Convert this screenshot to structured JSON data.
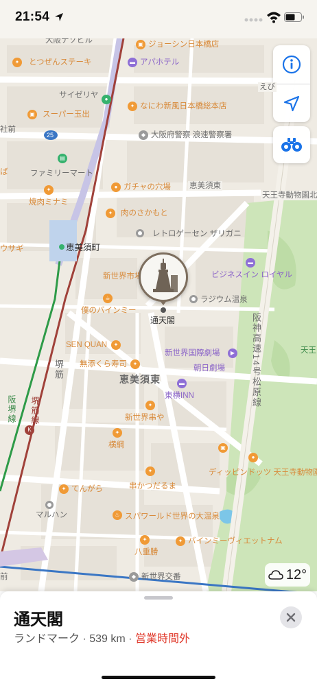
{
  "status": {
    "time": "21:54"
  },
  "map": {
    "labels": {
      "osaka_navi": "大阪ナゾビル",
      "joshin": "ジョーシン日本橋店",
      "tozen": "とつぜんステーキ",
      "apa": "アパホテル",
      "saizeriya": "サイゼリヤ",
      "naniwa": "なにわ新風日本橋総本店",
      "super_tamade": "スーパー玉出",
      "police": "大阪府警察 浪速警察署",
      "route25": "25",
      "familymart": "ファミリーマート",
      "gacha": "ガチャの穴場",
      "ebisu_higashi_small": "恵美須東",
      "tennoji_zoo_small": "天王寺動物園北",
      "yakiniku": "焼肉ミナミ",
      "niku": "肉のさかもと",
      "retro": "レトロゲーセン ザリガニ",
      "usagi": "ウサギ",
      "ebisucho": "恵美須町",
      "shinsekai_ichiba": "新世界市場",
      "radium": "ラジウム温泉",
      "biz_inn": "ビジネスイン ロイヤル",
      "boku_bain": "僕のバインミー",
      "tsutenkaku": "通天閣",
      "hanshin": "阪神高速14号松原線",
      "sen_quan": "SEN QUAN",
      "shinsekai_kokusai": "新世界国際劇場",
      "muten": "無添くら寿司",
      "asahi": "朝日劇場",
      "sakaisuji": "堺筋",
      "ebisu_higashi": "恵美須東",
      "toyoko": "東横INN",
      "hankai": "阪堺線",
      "sakaisuji_line": "堺筋線",
      "shinsekai_kushiya": "新世界串や",
      "yokozuna": "横綱",
      "tennoji_east": "天王",
      "zoo": "ディッピンドッツ 天王寺動物園内FooZoo",
      "tengara": "てんがら",
      "kushikatsu": "串かつだるま",
      "maruhan": "マルハン",
      "spa": "スパワールド世界の大温泉",
      "bain_viet": "バインミーヴィエットナム",
      "yaejikatsu": "八重勝",
      "shinsekai_koban": "新世界交番",
      "mae": "前",
      "ebi": "えび",
      "ba": "ば",
      "sha": "社前"
    },
    "weather": {
      "temp": "12°"
    }
  },
  "sheet": {
    "title": "通天閣",
    "category": "ランドマーク",
    "distance": "539 km",
    "status": "営業時間外",
    "sep": "·"
  },
  "colors": {
    "accent": "#1a73e8",
    "closed": "#e0392b",
    "park": "#cde5b9"
  }
}
